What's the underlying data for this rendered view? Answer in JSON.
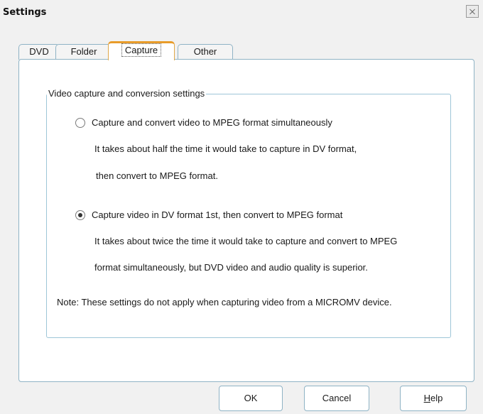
{
  "window": {
    "title": "Settings",
    "close_icon": "close-icon"
  },
  "tabs": [
    {
      "label": "DVD",
      "active": false
    },
    {
      "label": "Folder",
      "active": false
    },
    {
      "label": "Capture",
      "active": true
    },
    {
      "label": "Other",
      "active": false
    }
  ],
  "capture": {
    "group_title": "Video capture and conversion settings",
    "options": [
      {
        "label": "Capture and convert video to MPEG format simultaneously",
        "checked": false,
        "description": [
          "It takes about half the time it would take to capture in DV format,",
          "then convert to MPEG format."
        ]
      },
      {
        "label": "Capture video in DV format 1st, then convert to MPEG format",
        "checked": true,
        "description": [
          "It takes about twice the time it would take to capture and convert to MPEG",
          "format simultaneously, but DVD video and audio quality is superior."
        ]
      }
    ],
    "note": "Note: These settings do not apply when capturing video from a MICROMV device."
  },
  "buttons": {
    "ok": "OK",
    "cancel": "Cancel",
    "help_accel": "H",
    "help_rest": "elp"
  }
}
